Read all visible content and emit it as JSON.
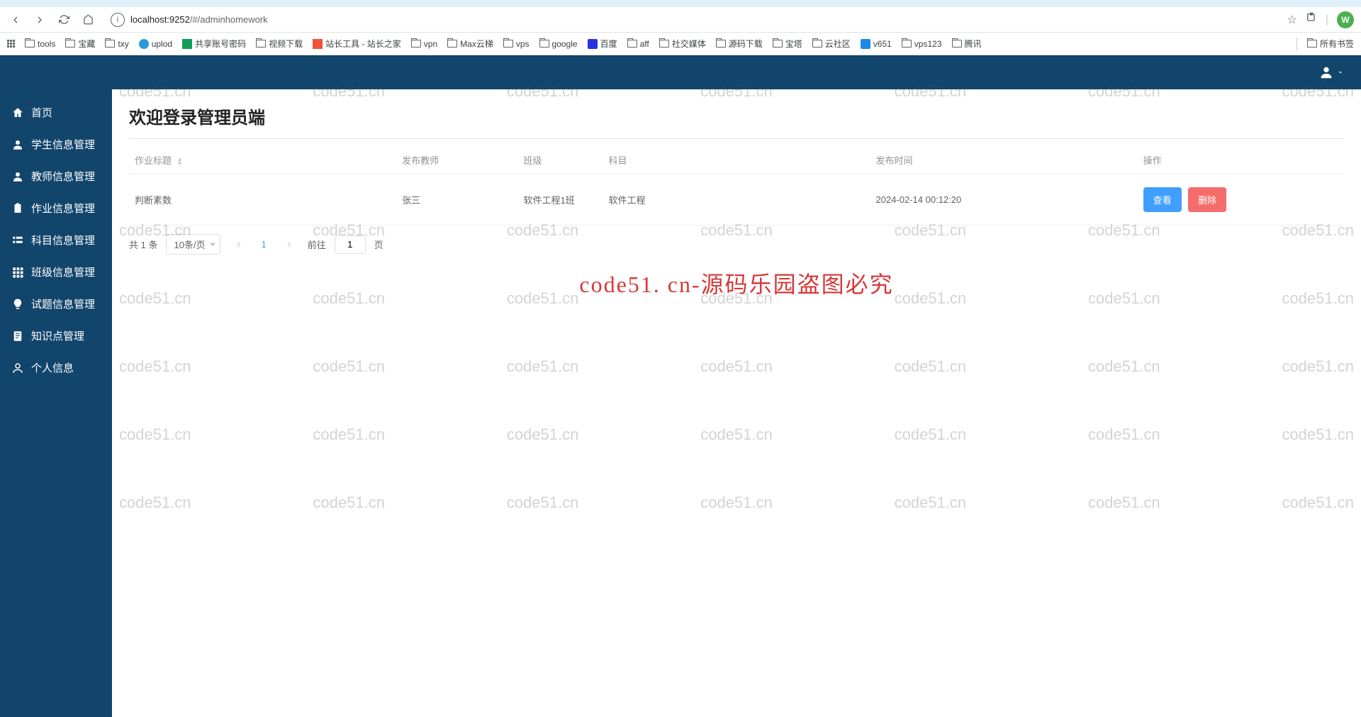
{
  "browser": {
    "url_host": "localhost:",
    "url_port": "9252",
    "url_path": "/#/adminhomework",
    "avatar_letter": "W"
  },
  "bookmarks": [
    "tools",
    "宝藏",
    "txy",
    "uplod",
    "共享账号密码",
    "视频下载",
    "站长工具 - 站长之家",
    "vpn",
    "Max云梯",
    "vps",
    "google",
    "百度",
    "aff",
    "社交媒体",
    "源码下载",
    "宝塔",
    "云社区",
    "v651",
    "vps123",
    "腾讯"
  ],
  "bookmarks_right": "所有书签",
  "sidebar": {
    "items": [
      {
        "label": "首页",
        "icon": "home"
      },
      {
        "label": "学生信息管理",
        "icon": "user"
      },
      {
        "label": "教师信息管理",
        "icon": "user"
      },
      {
        "label": "作业信息管理",
        "icon": "clipboard"
      },
      {
        "label": "科目信息管理",
        "icon": "list"
      },
      {
        "label": "班级信息管理",
        "icon": "grid"
      },
      {
        "label": "试题信息管理",
        "icon": "bulb"
      },
      {
        "label": "知识点管理",
        "icon": "note"
      },
      {
        "label": "个人信息",
        "icon": "person"
      }
    ]
  },
  "page": {
    "title": "欢迎登录管理员端"
  },
  "table": {
    "headers": {
      "title": "作业标题",
      "teacher": "发布教师",
      "class": "班级",
      "subject": "科目",
      "time": "发布时间",
      "actions": "操作"
    },
    "row": {
      "title": "判断素数",
      "teacher": "张三",
      "class": "软件工程1班",
      "subject": "软件工程",
      "time": "2024-02-14 00:12:20"
    },
    "actions": {
      "view": "查看",
      "delete": "删除"
    }
  },
  "pagination": {
    "total_text": "共 1 条",
    "page_size": "10条/页",
    "current": "1",
    "jump_prefix": "前往",
    "jump_value": "1",
    "jump_suffix": "页"
  },
  "watermark": {
    "small": "code51.cn",
    "center": "code51. cn-源码乐园盗图必究"
  }
}
